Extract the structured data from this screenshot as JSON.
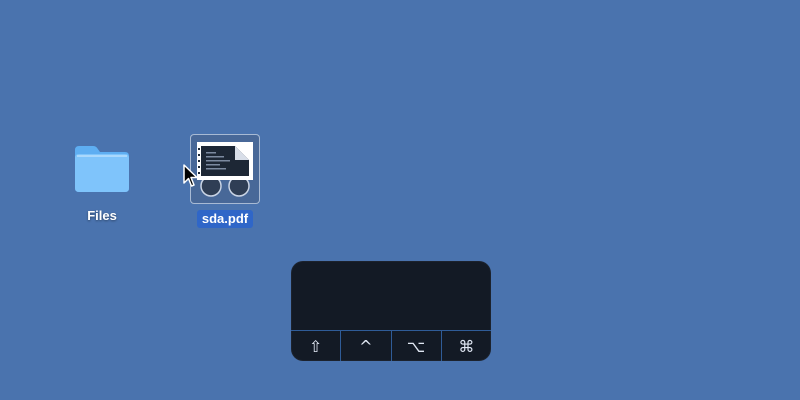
{
  "desktop": {
    "background_color": "#4a73ae",
    "items": [
      {
        "label": "Files",
        "icon": "folder-icon"
      },
      {
        "label": "sda.pdf",
        "icon": "pdf-document-icon",
        "selected": true
      }
    ]
  },
  "cursor": {
    "icon": "arrow-pointer-icon"
  },
  "keyboard_panel": {
    "modifier_keys": [
      {
        "name": "shift",
        "glyph": "⇧",
        "icon": "shift-icon"
      },
      {
        "name": "control",
        "glyph": "^",
        "icon": "control-icon"
      },
      {
        "name": "option",
        "glyph": "⌥",
        "icon": "option-icon"
      },
      {
        "name": "command",
        "glyph": "⌘",
        "icon": "command-icon"
      }
    ]
  }
}
